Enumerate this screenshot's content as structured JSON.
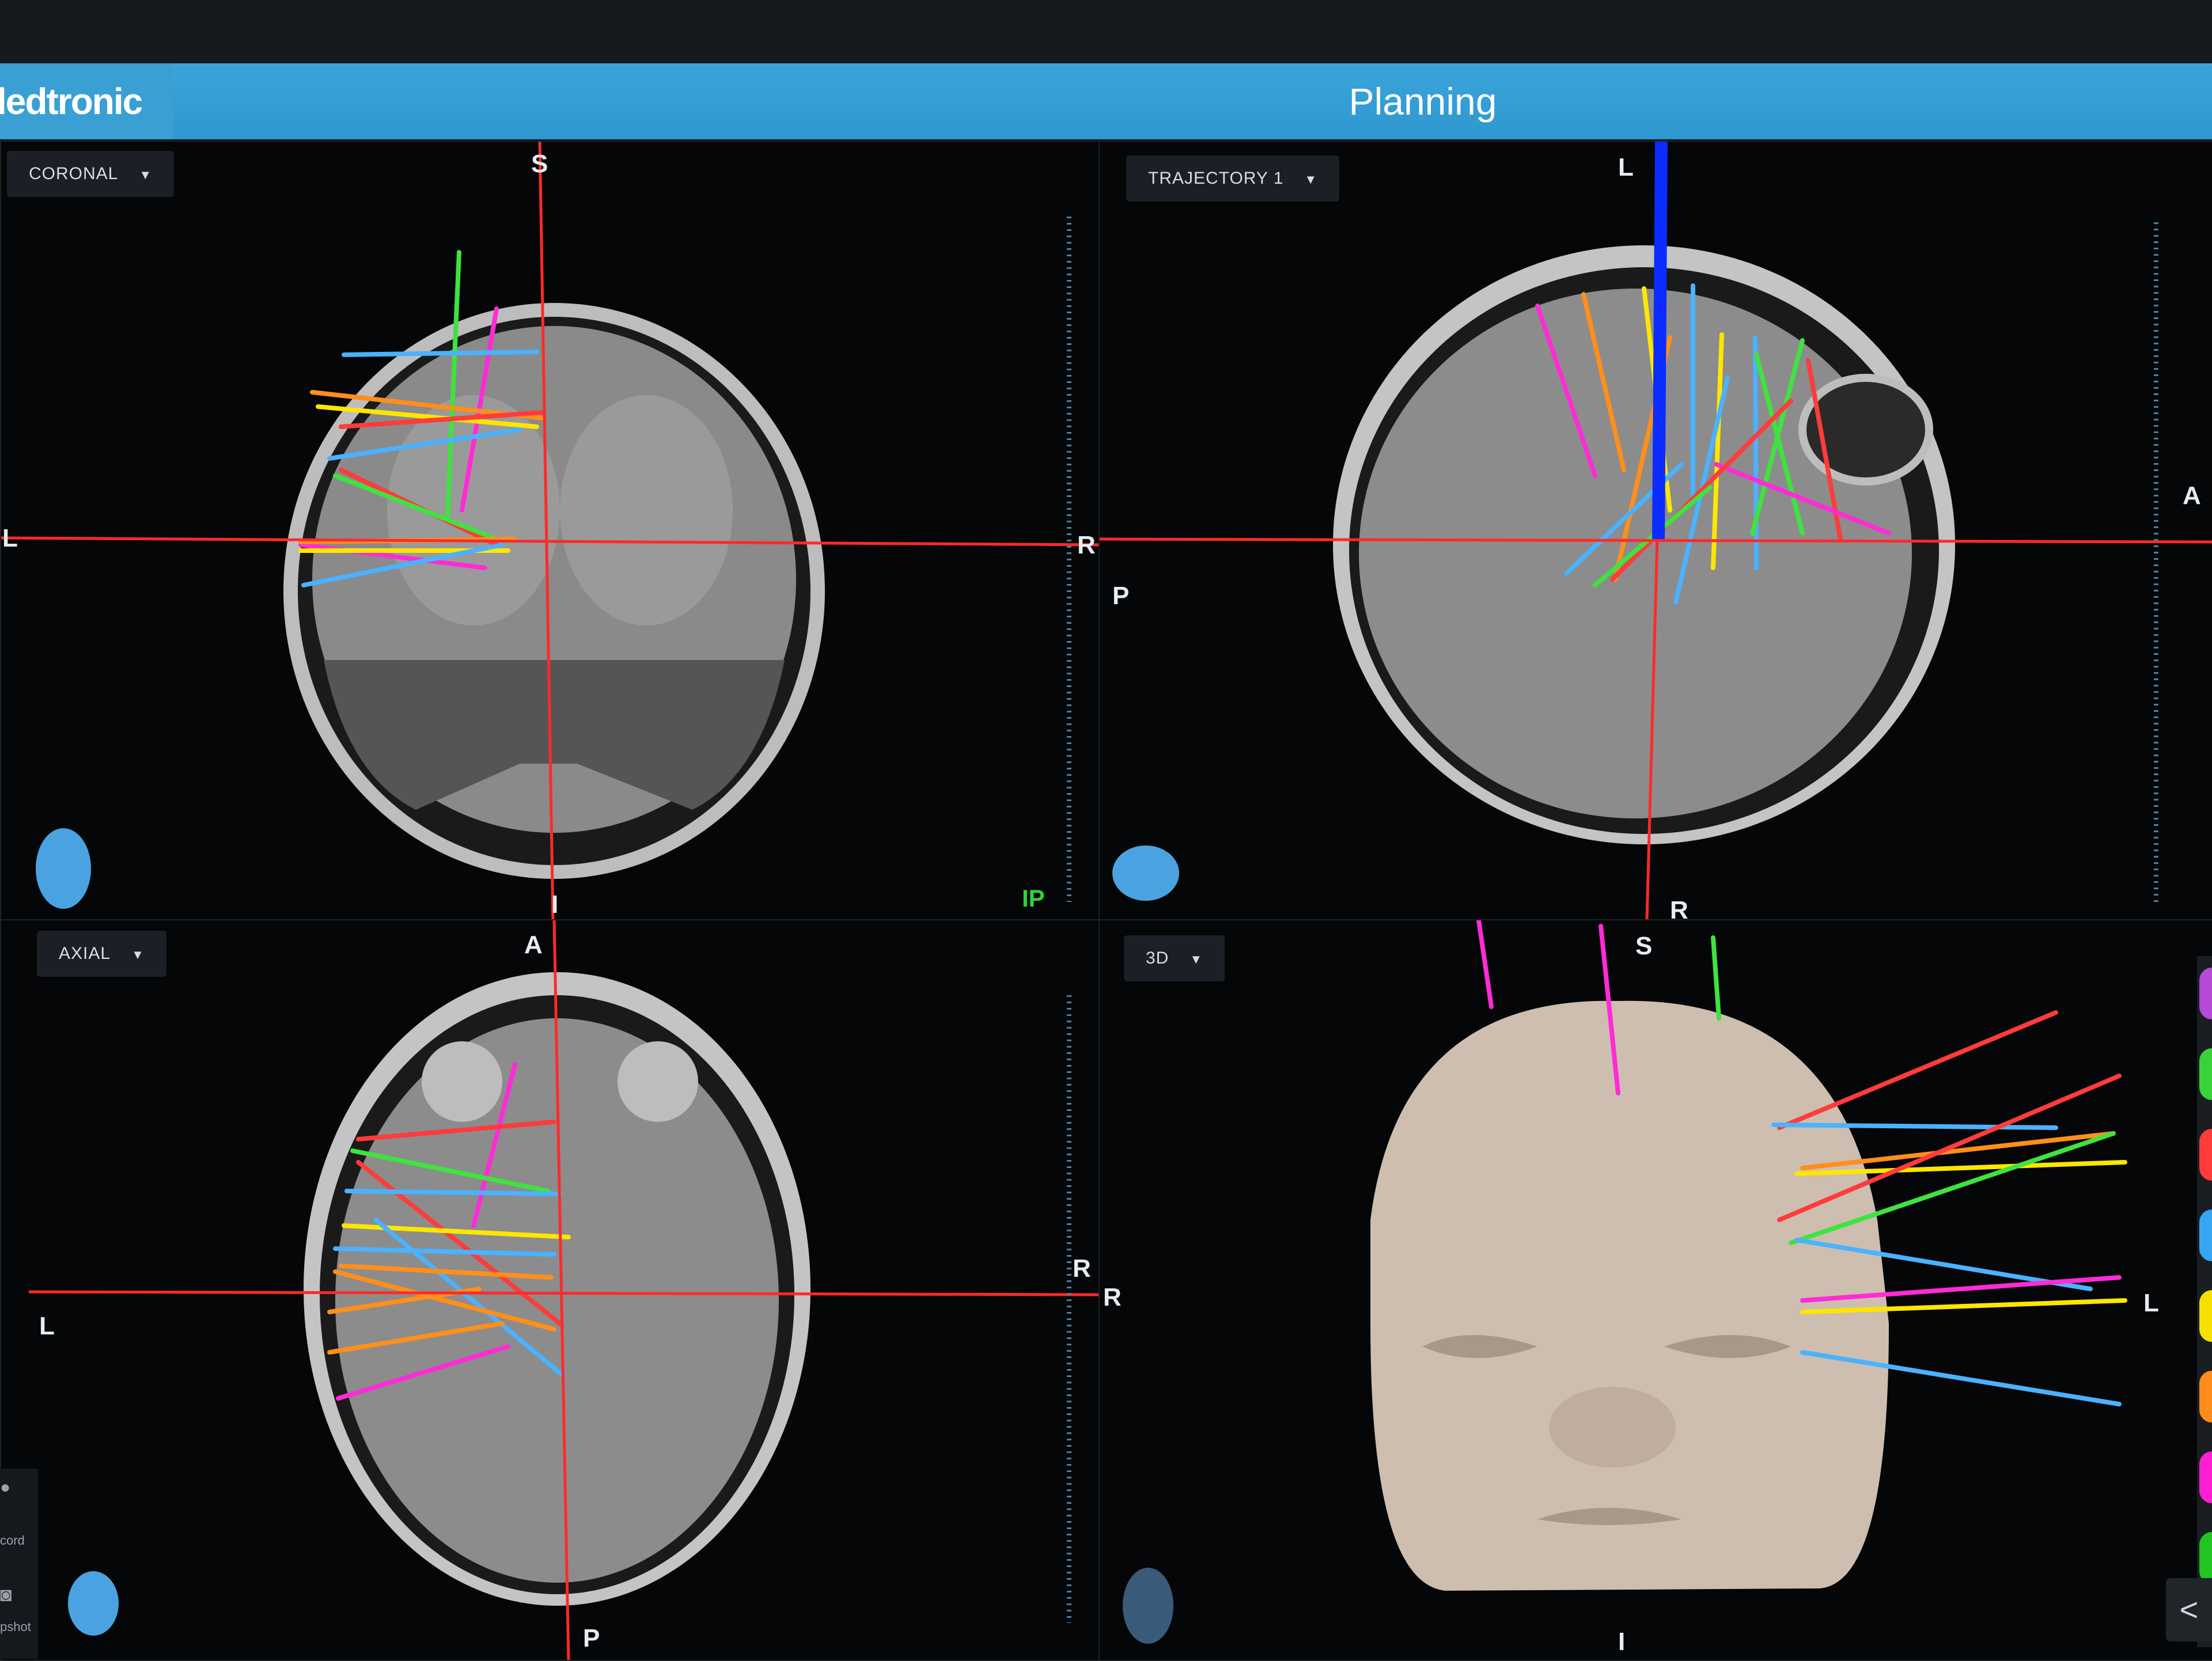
{
  "header": {
    "brand": "ledtronic",
    "title": "Planning"
  },
  "viewports": {
    "coronal": {
      "dropdown": "CORONAL",
      "labels": {
        "top": "S",
        "left": "L",
        "right": "R",
        "bottom": "I"
      },
      "status": "IP"
    },
    "trajectory": {
      "dropdown": "TRAJECTORY 1",
      "labels": {
        "top": "L",
        "left": "P",
        "right": "A",
        "bottom": "R"
      }
    },
    "axial": {
      "dropdown": "AXIAL",
      "labels": {
        "top": "A",
        "left": "L",
        "right": "R",
        "bottom": "P"
      }
    },
    "three_d": {
      "dropdown": "3D",
      "labels": {
        "top": "S",
        "left": "R",
        "bottom": "I",
        "side": "L"
      }
    }
  },
  "sidebar": {
    "record_label": "cord",
    "snapshot_label": "pshot"
  },
  "palette_colors": [
    "#b44ad6",
    "#39d239",
    "#ff3b3b",
    "#36a6f2",
    "#f5e000",
    "#ff8c1a",
    "#ff1fd2",
    "#21c421"
  ],
  "collapse_label": "<",
  "dropdown_caret": "▼",
  "colors": {
    "header": "#3aa5db",
    "crosshair": "#ff2a2a",
    "trajectory_blue": "#0a2cff",
    "ip_text": "#31d431"
  }
}
